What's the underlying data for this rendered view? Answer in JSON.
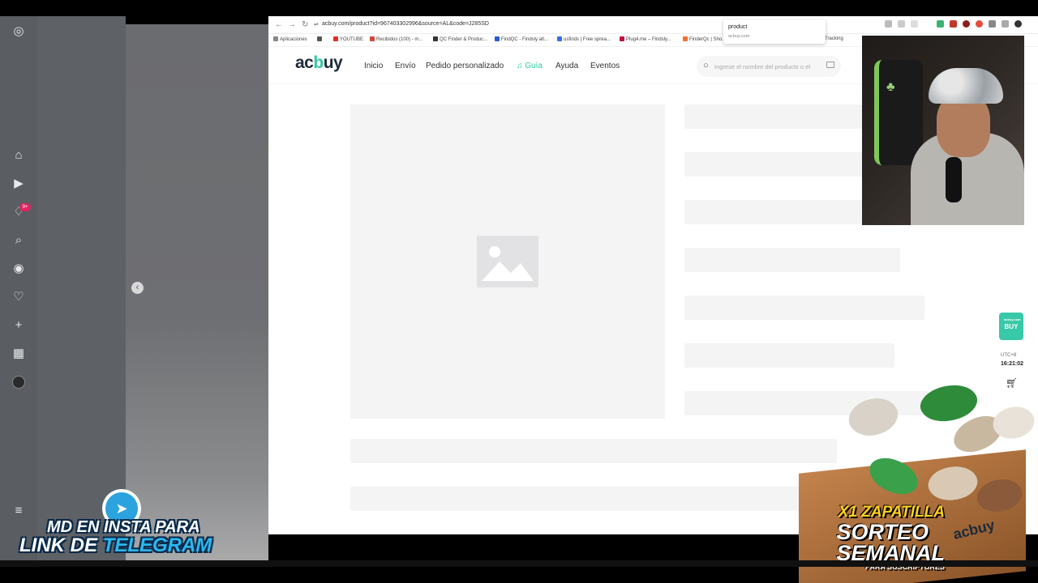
{
  "browser": {
    "url": "acbuy.com/product?id=967403302996&source=AL&code=J285SD",
    "bookmarks": [
      "Aplicaciones",
      "YOUTUBE",
      "Recibidos (100) - m...",
      "QC Finder & Produc...",
      "FindQC - Findsly alt...",
      "usfinds | Free sprea...",
      "Plug4.me – Findsly...",
      "FinderQc | Sho...",
      "Tracking"
    ],
    "tooltip_title": "product",
    "tooltip_url": "acbuy.com"
  },
  "site": {
    "logo_pre": "ac",
    "logo_mid": "b",
    "logo_post": "uy",
    "nav": [
      "Inicio",
      "Envío",
      "Pedido personalizado",
      "Guía",
      "Ayuda",
      "Eventos"
    ],
    "search_placeholder": "Ingrese el nombre del producto o el"
  },
  "widget": {
    "bag_label": "BUY",
    "bag_small": "acbuy.com",
    "utc": "UTC+8",
    "time": "16:21:02"
  },
  "ig": {
    "badge": "9+"
  },
  "promo": {
    "line1": "X1 ZAPATILLA",
    "line2": "SORTEO",
    "line3": "SEMANAL",
    "line4": "PARA SUSCRIPTORES",
    "logo": "acbuy"
  },
  "telegram": {
    "line1": "MD EN INSTA PARA",
    "line2a": "LINK DE ",
    "line2b": "TELEGRAM"
  },
  "colors": {
    "accent": "#2ccaa0",
    "skeleton": "#f4f4f5",
    "telegram": "#2aa3de"
  }
}
